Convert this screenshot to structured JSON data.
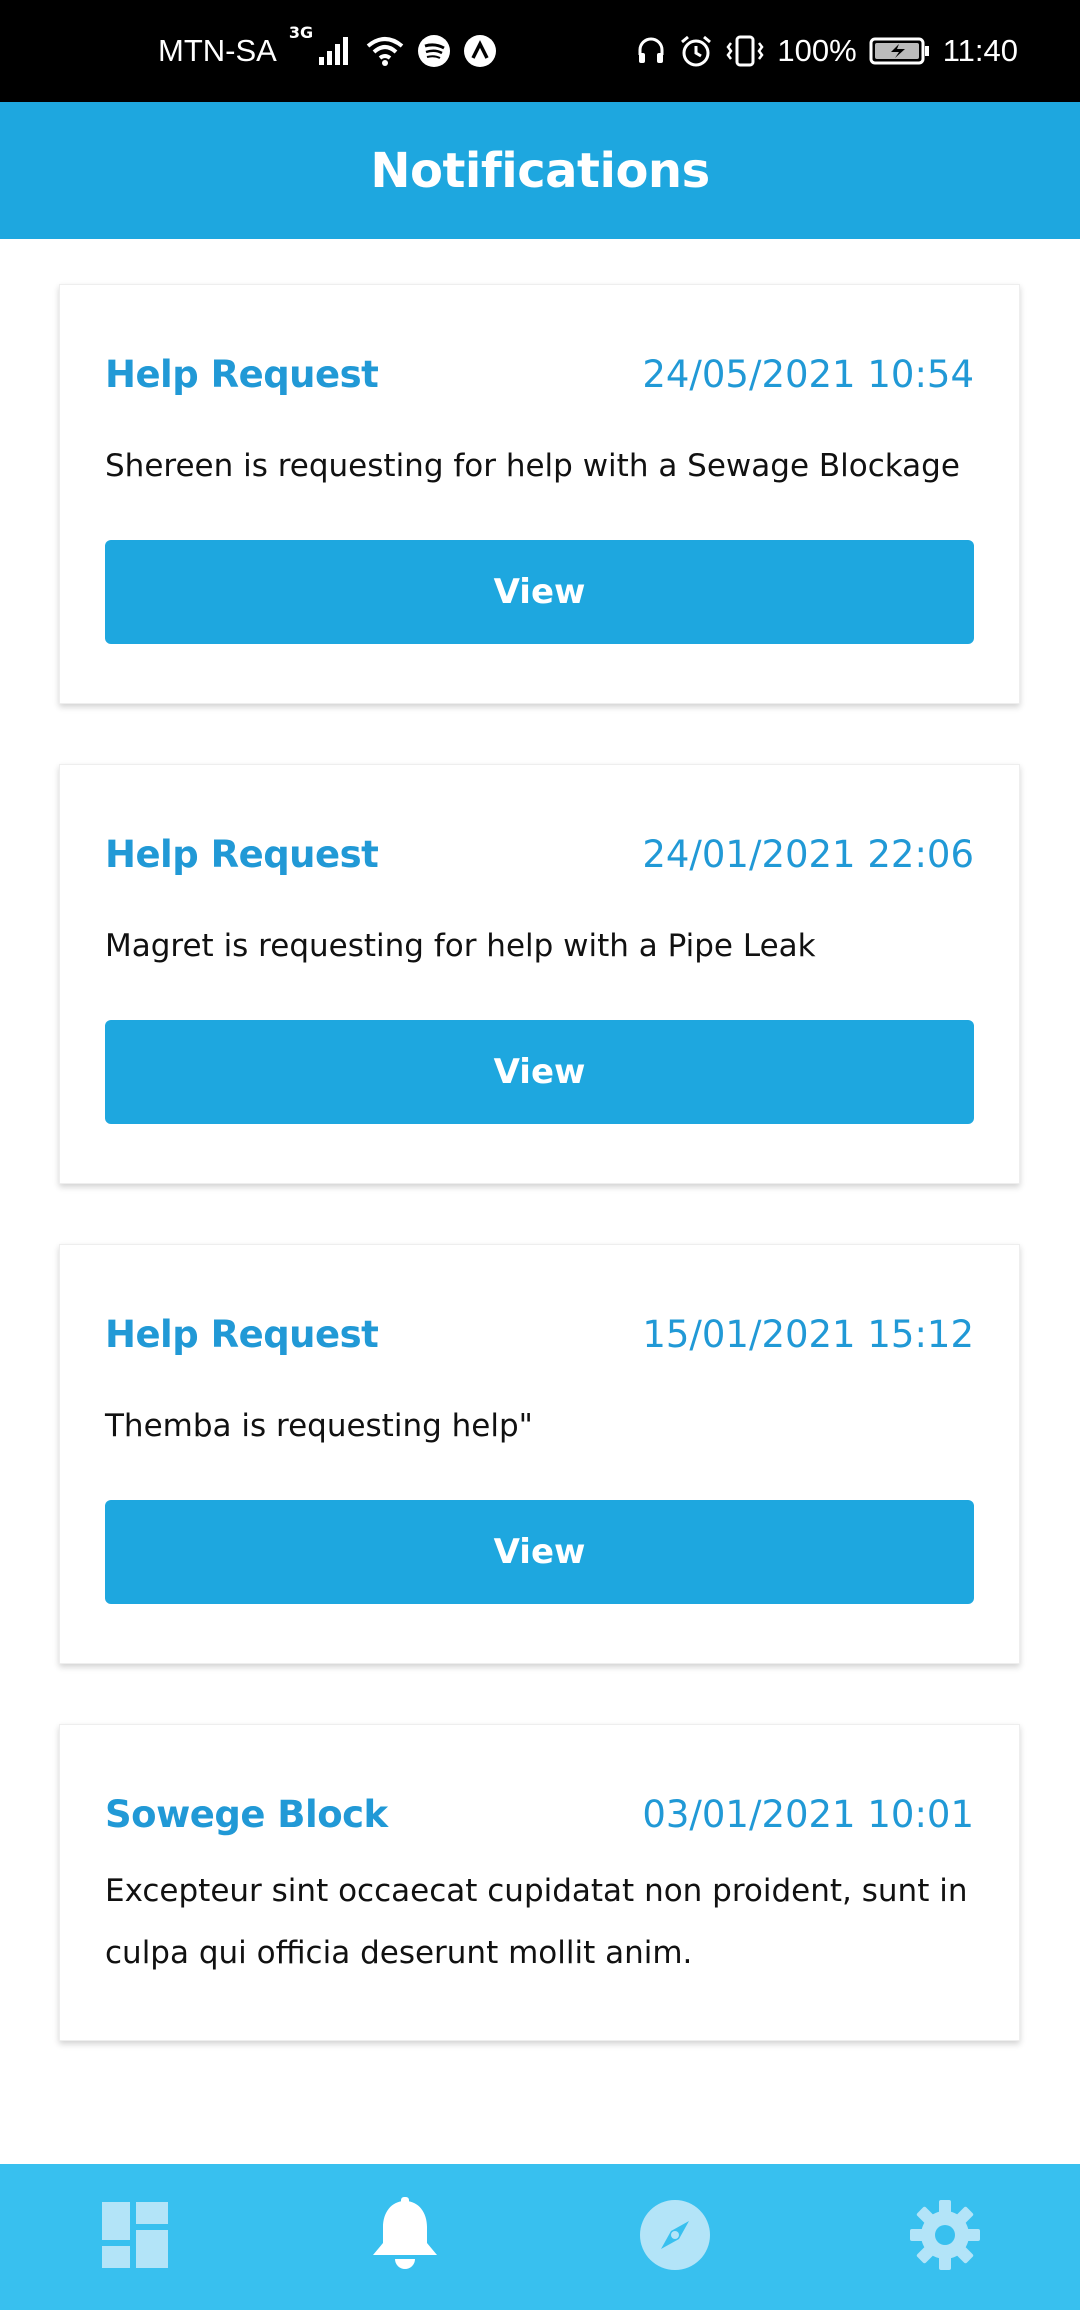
{
  "status_bar": {
    "carrier": "MTN-SA",
    "network": "3G",
    "battery": "100%",
    "time": "11:40",
    "icons": [
      "signal-icon",
      "wifi-icon",
      "spotify-icon",
      "app-a-icon",
      "headphones-icon",
      "alarm-icon",
      "vibrate-icon",
      "battery-charging-icon"
    ]
  },
  "header": {
    "title": "Notifications"
  },
  "notifications": [
    {
      "title": "Help Request",
      "date": "24/05/2021 10:54",
      "message": "Shereen is requesting for help with a Sewage Blockage",
      "button_label": "View"
    },
    {
      "title": "Help Request",
      "date": "24/01/2021 22:06",
      "message": "Magret is requesting for help with a Pipe Leak",
      "button_label": "View"
    },
    {
      "title": "Help Request",
      "date": "15/01/2021 15:12",
      "message": "Themba is requesting help\"",
      "button_label": "View"
    },
    {
      "title": "Sowege Block",
      "date": "03/01/2021 10:01",
      "message": "Excepteur sint occaecat cupidatat non proident, sunt in culpa qui officia deserunt mollit anim."
    }
  ],
  "bottom_nav": {
    "items": [
      {
        "icon": "dashboard-icon",
        "active": false
      },
      {
        "icon": "bell-icon",
        "active": true
      },
      {
        "icon": "compass-icon",
        "active": false
      },
      {
        "icon": "gear-icon",
        "active": false
      }
    ]
  },
  "colors": {
    "primary": "#1ea7df",
    "nav_background": "#38c0ef",
    "title_text": "#2199d6",
    "inactive_icon": "#b3e4f8"
  }
}
